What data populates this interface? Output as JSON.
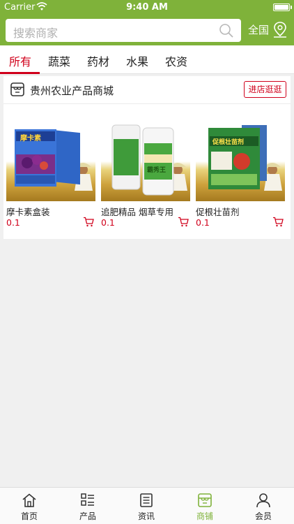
{
  "status_bar": {
    "carrier": "Carrier",
    "time": "9:40 AM"
  },
  "header": {
    "search_placeholder": "搜索商家",
    "region": "全国"
  },
  "tabs": [
    {
      "label": "所有",
      "active": true
    },
    {
      "label": "蔬菜",
      "active": false
    },
    {
      "label": "药材",
      "active": false
    },
    {
      "label": "水果",
      "active": false
    },
    {
      "label": "农资",
      "active": false
    }
  ],
  "shop": {
    "name": "贵州农业产品商城",
    "visit_label": "进店逛逛",
    "products": [
      {
        "name": "摩卡素盒装",
        "price": "0.1",
        "box_text": "摩卡素"
      },
      {
        "name": "追肥精品 烟草专用",
        "price": "0.1",
        "box_text": "霸秀王"
      },
      {
        "name": "促根壮苗剂",
        "price": "0.1",
        "box_text": "促根壮苗剂"
      }
    ]
  },
  "bottom_nav": [
    {
      "label": "首页",
      "icon": "home-icon",
      "active": false
    },
    {
      "label": "产品",
      "icon": "grid-list-icon",
      "active": false
    },
    {
      "label": "资讯",
      "icon": "news-icon",
      "active": false
    },
    {
      "label": "商铺",
      "icon": "shop-icon",
      "active": true
    },
    {
      "label": "会员",
      "icon": "user-icon",
      "active": false
    }
  ],
  "colors": {
    "brand_green": "#7fb23a",
    "accent_red": "#d0001b"
  }
}
